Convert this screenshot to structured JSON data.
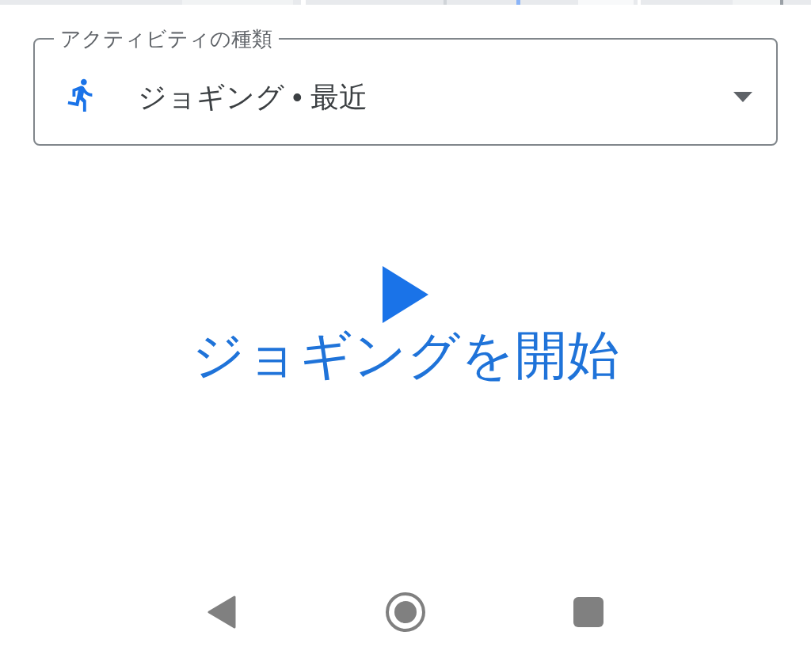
{
  "activity_field": {
    "label": "アクティビティの種類",
    "value": "ジョギング • 最近"
  },
  "start_button": {
    "label": "ジョギングを開始"
  }
}
